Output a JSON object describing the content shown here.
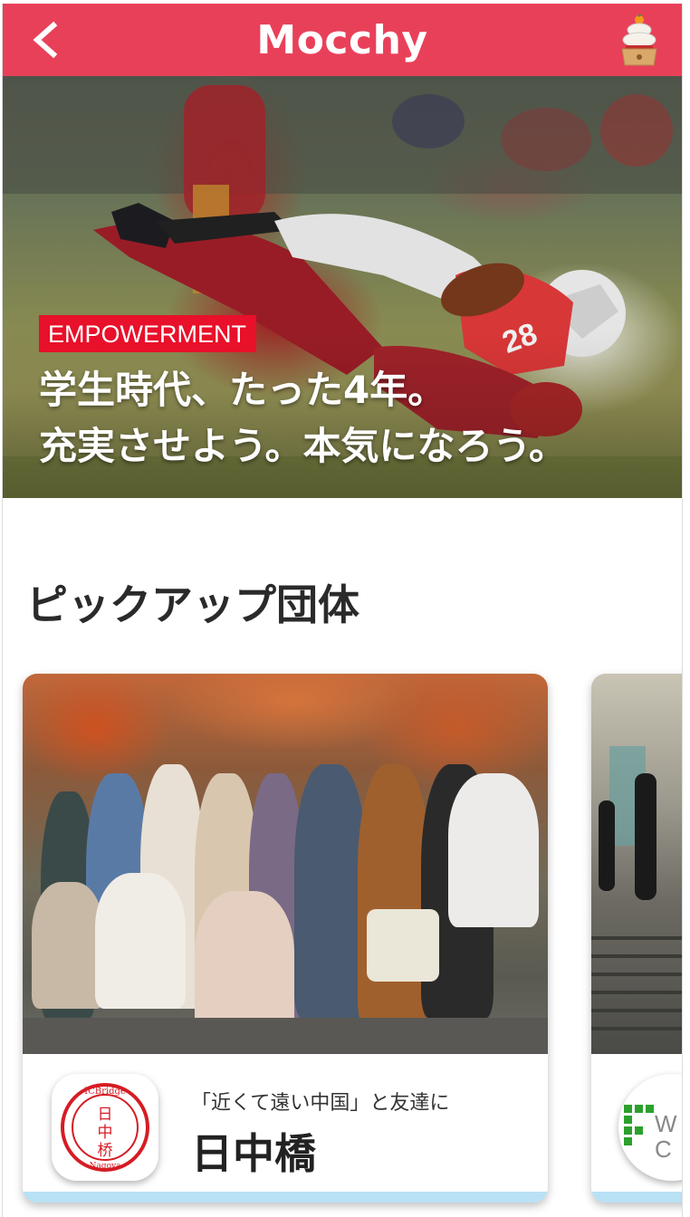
{
  "header": {
    "title": "Mocchy",
    "back_icon": "chevron-left-icon",
    "right_icon": "kagami-mochi-icon",
    "color": "#e9405a"
  },
  "hero": {
    "badge": "EMPOWERMENT",
    "headline_line1": "学生時代、たった4年。",
    "headline_line2": "充実させよう。本気になろう。",
    "badge_color": "#e8102a"
  },
  "pickup": {
    "title": "ピックアップ団体",
    "cards": [
      {
        "tagline": "「近くて遠い中国」と友達に",
        "name": "日中橋",
        "logo": {
          "top": "ICBridge",
          "chars": [
            "日",
            "中",
            "桥"
          ],
          "bottom": "Nagoya"
        }
      },
      {
        "logo_fragment_1": "W",
        "logo_fragment_2": "C"
      }
    ]
  }
}
